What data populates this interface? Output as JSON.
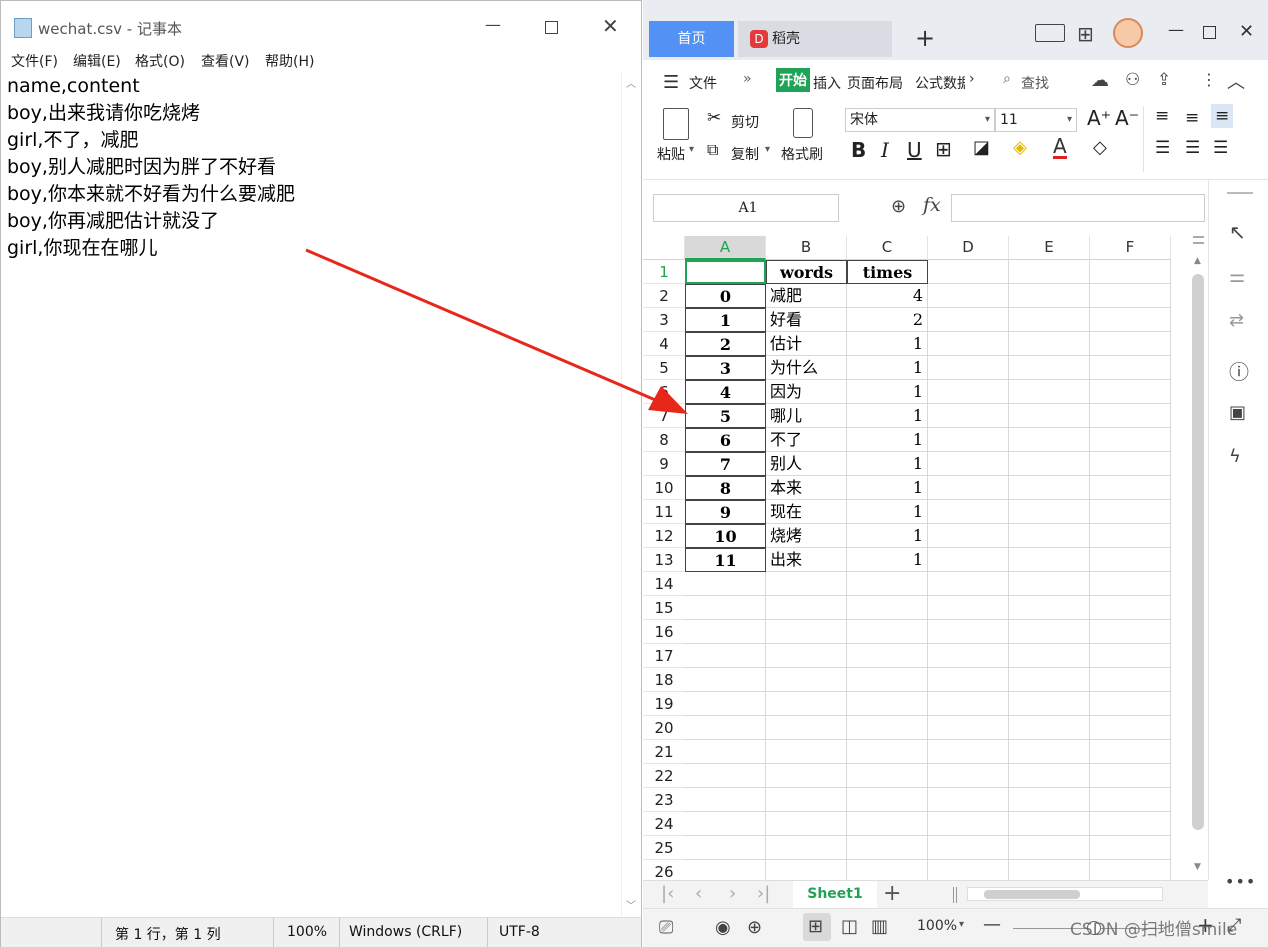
{
  "notepad": {
    "title": "wechat.csv - 记事本",
    "menu": [
      "文件(F)",
      "编辑(E)",
      "格式(O)",
      "查看(V)",
      "帮助(H)"
    ],
    "lines": [
      "name,content",
      "boy,出来我请你吃烧烤",
      "girl,不了，减肥",
      "boy,别人减肥时因为胖了不好看",
      "boy,你本来就不好看为什么要减肥",
      "boy,你再减肥估计就没了",
      "girl,你现在在哪儿"
    ],
    "status": {
      "position": "第 1 行，第 1 列",
      "zoom": "100%",
      "eol": "Windows (CRLF)",
      "encoding": "UTF-8"
    }
  },
  "wps": {
    "tabs": {
      "home": "首页",
      "doc": "稻壳"
    },
    "menu": {
      "file": "文件",
      "start": "开始",
      "insert": "插入",
      "layout": "页面布局",
      "formula": "公式",
      "data": "数据",
      "search": "查找"
    },
    "ribbon": {
      "paste": "粘贴",
      "cut": "剪切",
      "copy": "复制",
      "format_painter": "格式刷",
      "font_name": "宋体",
      "font_size": "11"
    },
    "name_box": "A1",
    "fx": "fx",
    "columns": [
      "A",
      "B",
      "C",
      "D",
      "E",
      "F"
    ],
    "rows": [
      "1",
      "2",
      "3",
      "4",
      "5",
      "6",
      "7",
      "8",
      "9",
      "10",
      "11",
      "12",
      "13",
      "14",
      "15",
      "16",
      "17",
      "18",
      "19",
      "20",
      "21",
      "22",
      "23",
      "24",
      "25",
      "26"
    ],
    "headers": {
      "b": "words",
      "c": "times"
    },
    "table": [
      {
        "idx": "0",
        "word": "减肥",
        "times": "4"
      },
      {
        "idx": "1",
        "word": "好看",
        "times": "2"
      },
      {
        "idx": "2",
        "word": "估计",
        "times": "1"
      },
      {
        "idx": "3",
        "word": "为什么",
        "times": "1"
      },
      {
        "idx": "4",
        "word": "因为",
        "times": "1"
      },
      {
        "idx": "5",
        "word": "哪儿",
        "times": "1"
      },
      {
        "idx": "6",
        "word": "不了",
        "times": "1"
      },
      {
        "idx": "7",
        "word": "别人",
        "times": "1"
      },
      {
        "idx": "8",
        "word": "本来",
        "times": "1"
      },
      {
        "idx": "9",
        "word": "现在",
        "times": "1"
      },
      {
        "idx": "10",
        "word": "烧烤",
        "times": "1"
      },
      {
        "idx": "11",
        "word": "出来",
        "times": "1"
      }
    ],
    "sheet_tab": "Sheet1",
    "status_zoom": "100%"
  },
  "watermark": "CSDN @扫地僧smile",
  "colors": {
    "accent_blue": "#5391f5",
    "sheet_green": "#1fa356",
    "arrow_red": "#e8271b"
  }
}
